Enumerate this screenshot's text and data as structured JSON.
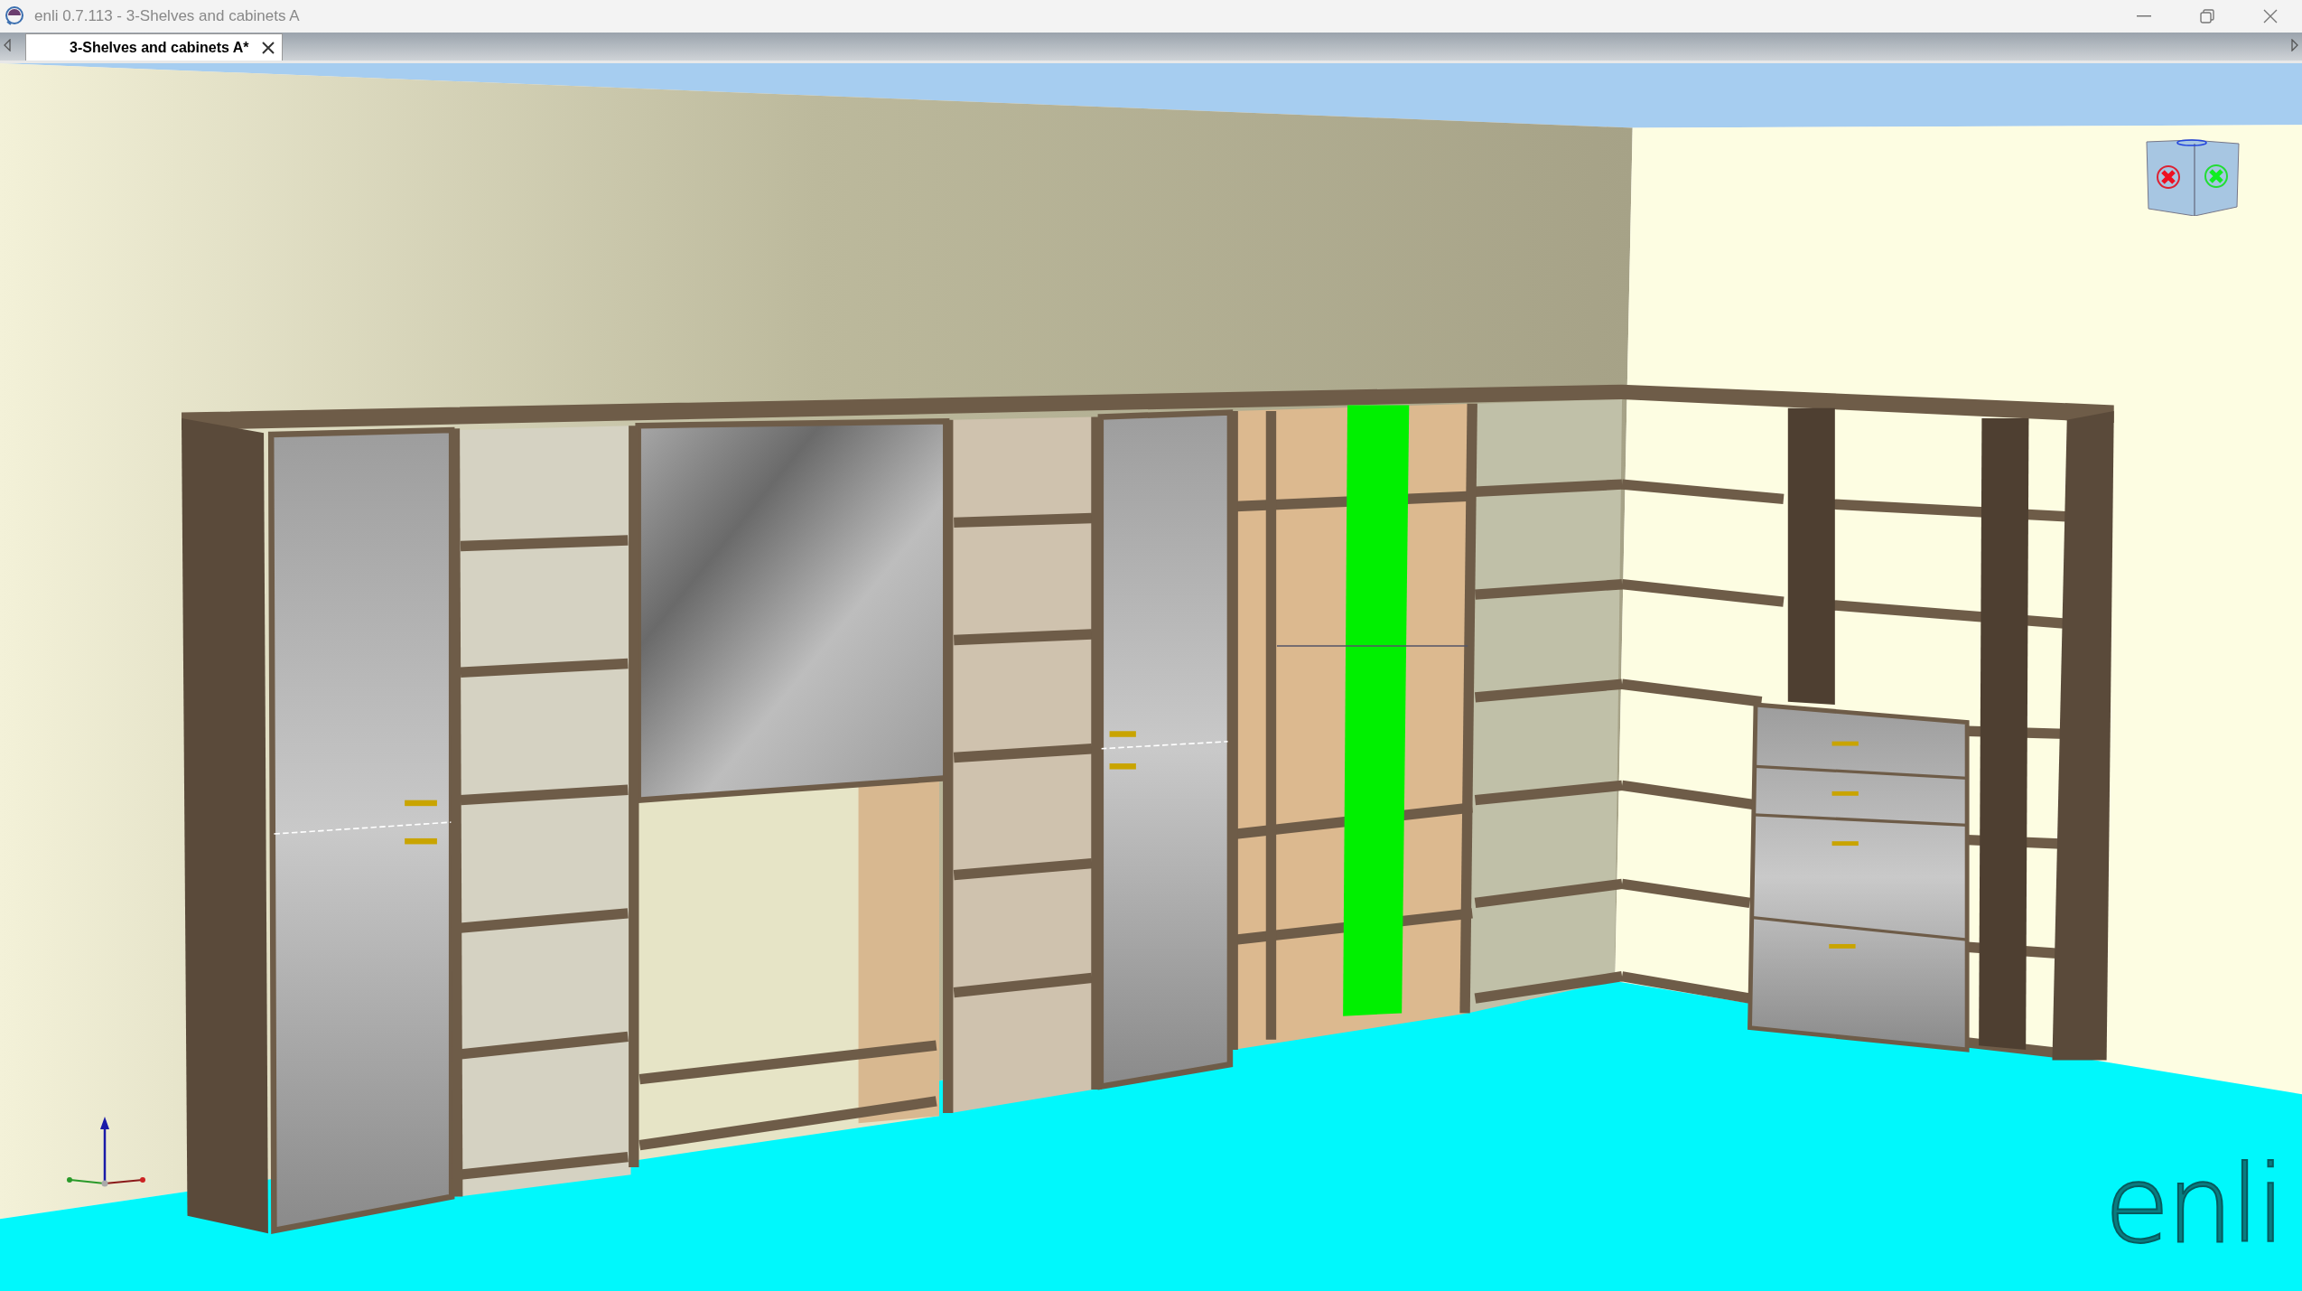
{
  "window": {
    "title": "enli 0.7.113 - 3-Shelves and cabinets A"
  },
  "tabs": [
    {
      "label": "3-Shelves and cabinets A*",
      "selected": true
    }
  ],
  "viewport": {
    "logo": "enli"
  }
}
